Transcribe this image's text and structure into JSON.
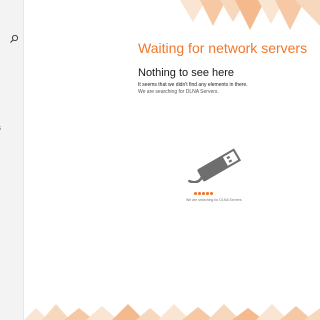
{
  "sidebar": {
    "search_icon": "search-icon",
    "item_label": "ces"
  },
  "main": {
    "status_title": "Waiting for network servers",
    "empty_heading": "Nothing to see here",
    "empty_description": "It seems that we didn't find any elements in there.",
    "empty_subdescription": "We are searching for DLNA Servers.",
    "illustration_icon": "usb-plug-icon",
    "progress_text": "We are searching for DLNA Servers"
  },
  "colors": {
    "accent": "#f0782a",
    "sidebar_bg": "#f3f3f3",
    "band_colors": [
      "#f6c8a3",
      "#f8d8bd",
      "#fae4d2",
      "#f4b98c"
    ]
  }
}
